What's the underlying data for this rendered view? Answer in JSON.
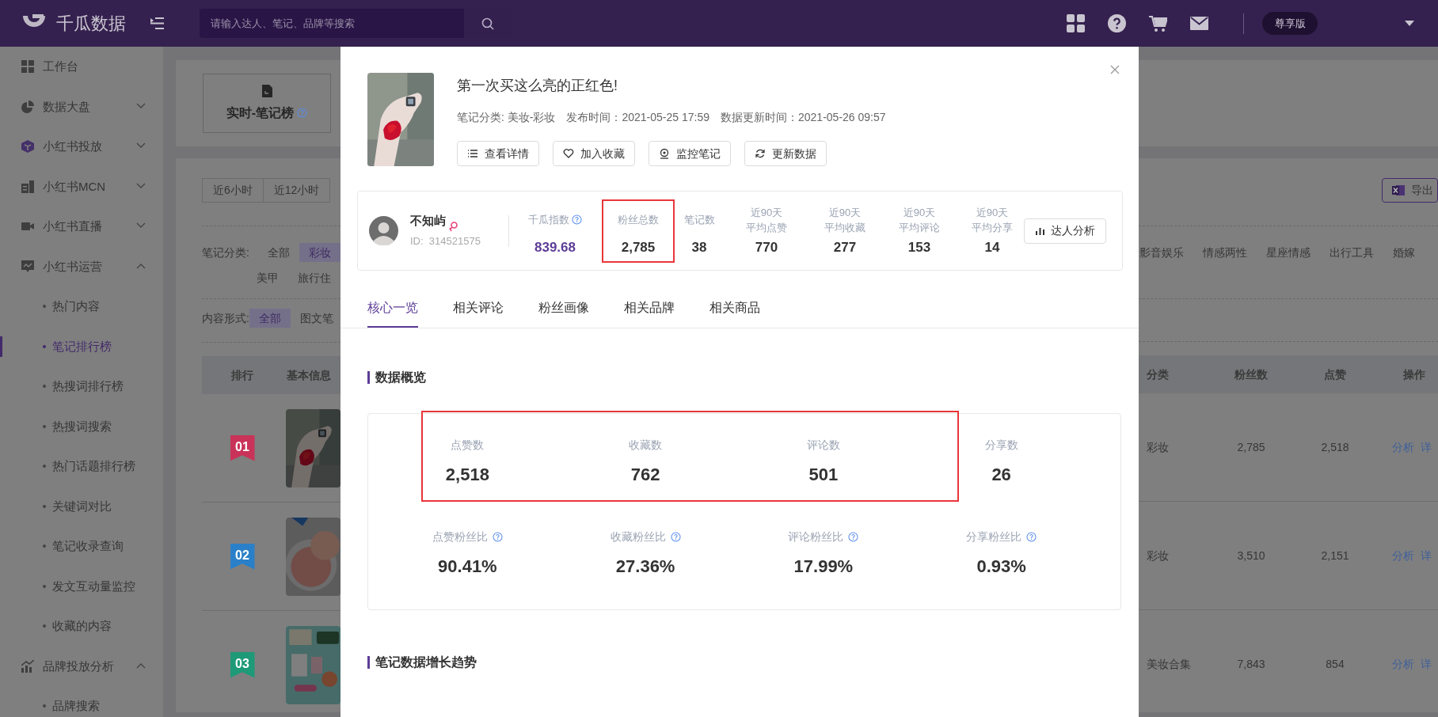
{
  "top_bar": {
    "brand": "千瓜数据",
    "search": {
      "placeholder": "请输入达人、笔记、品牌等搜索"
    },
    "plan_badge": "尊享版"
  },
  "sidebar": {
    "items": [
      {
        "label": "工作台",
        "selected": false
      },
      {
        "label": "数据大盘",
        "expanded": false,
        "selected": false
      },
      {
        "label": "小红书投放",
        "expanded": false,
        "selected": false
      },
      {
        "label": "小红书MCN",
        "expanded": false,
        "selected": false
      },
      {
        "label": "小红书直播",
        "expanded": false,
        "selected": false
      },
      {
        "label": "小红书运营",
        "expanded": true,
        "selected": false,
        "children": [
          {
            "label": "热门内容",
            "selected": false
          },
          {
            "label": "笔记排行榜",
            "selected": true
          },
          {
            "label": "热搜词排行榜",
            "selected": false
          },
          {
            "label": "热搜词搜索",
            "selected": false
          },
          {
            "label": "热门话题排行榜",
            "selected": false
          },
          {
            "label": "关键词对比",
            "selected": false
          },
          {
            "label": "笔记收录查询",
            "selected": false
          },
          {
            "label": "发文互动量监控",
            "selected": false
          },
          {
            "label": "收藏的内容",
            "selected": false
          }
        ]
      },
      {
        "label": "品牌投放分析",
        "expanded": true,
        "selected": false,
        "children": [
          {
            "label": "品牌搜索",
            "selected": false
          }
        ]
      }
    ]
  },
  "ranking_tab": {
    "label": "实时-笔记榜"
  },
  "time_filters": [
    {
      "label": "近6小时",
      "selected": false
    },
    {
      "label": "近12小时",
      "selected": false
    }
  ],
  "export_button": "导出",
  "note_category": {
    "label": "笔记分类:",
    "rows": [
      {
        "left": [
          {
            "label": "全部",
            "selected": false
          },
          {
            "label": "彩妆",
            "selected": true
          }
        ],
        "right": [
          {
            "label": "影音娱乐",
            "selected": false
          },
          {
            "label": "情感两性",
            "selected": false
          },
          {
            "label": "星座情感",
            "selected": false
          },
          {
            "label": "出行工具",
            "selected": false
          },
          {
            "label": "婚嫁",
            "selected": false
          }
        ]
      },
      {
        "left": [
          {
            "label": "美甲",
            "selected": false
          },
          {
            "label": "旅行住",
            "selected": false
          }
        ],
        "right": []
      }
    ]
  },
  "content_format": {
    "label": "内容形式:",
    "options": [
      {
        "label": "全部",
        "selected": true
      },
      {
        "label": "图文笔",
        "selected": false
      }
    ]
  },
  "table": {
    "columns": [
      "排行",
      "基本信息",
      "分类",
      "粉丝数",
      "点赞",
      "操作"
    ],
    "rows": [
      {
        "rank": "01",
        "color": "#c93359",
        "category": "彩妆",
        "fans": "2,785",
        "likes": "2,518",
        "actions": [
          "分析",
          "详"
        ]
      },
      {
        "rank": "02",
        "color": "#2a80c8",
        "category": "彩妆",
        "fans": "3,510",
        "likes": "2,151",
        "actions": [
          "分析",
          "详"
        ]
      },
      {
        "rank": "03",
        "color": "#1e9a78",
        "category": "美妆合集",
        "fans": "7,843",
        "likes": "854",
        "actions": [
          "分析",
          "详"
        ]
      }
    ]
  },
  "modal": {
    "title": "第一次买这么亮的正红色!",
    "meta": [
      "笔记分类: 美妆-彩妆",
      "发布时间：2021-05-25 17:59",
      "数据更新时间：2021-05-26 09:57"
    ],
    "actions": [
      "查看详情",
      "加入收藏",
      "监控笔记",
      "更新数据"
    ],
    "author": {
      "name": "不知屿",
      "id": "ID:  314521575"
    },
    "author_stats": [
      {
        "label_lines": [
          "千瓜指数"
        ],
        "value": "839.68",
        "kind": "index",
        "help": true,
        "highlighted": false
      },
      {
        "label_lines": [
          "粉丝总数"
        ],
        "value": "2,785",
        "kind": "plain",
        "help": false,
        "highlighted": true
      },
      {
        "label_lines": [
          "笔记数"
        ],
        "value": "38",
        "kind": "plain",
        "help": false,
        "highlighted": false
      },
      {
        "label_lines": [
          "近90天",
          "平均点赞"
        ],
        "value": "770",
        "kind": "plain",
        "help": false,
        "highlighted": false
      },
      {
        "label_lines": [
          "近90天",
          "平均收藏"
        ],
        "value": "277",
        "kind": "plain",
        "help": false,
        "highlighted": false
      },
      {
        "label_lines": [
          "近90天",
          "平均评论"
        ],
        "value": "153",
        "kind": "plain",
        "help": false,
        "highlighted": false
      },
      {
        "label_lines": [
          "近90天",
          "平均分享"
        ],
        "value": "14",
        "kind": "plain",
        "help": false,
        "highlighted": false
      }
    ],
    "author_button": "达人分析",
    "tabs": [
      {
        "label": "核心一览",
        "selected": true
      },
      {
        "label": "相关评论",
        "selected": false
      },
      {
        "label": "粉丝画像",
        "selected": false
      },
      {
        "label": "相关品牌",
        "selected": false
      },
      {
        "label": "相关商品",
        "selected": false
      }
    ],
    "overview": {
      "title": "数据概览",
      "metrics": [
        {
          "label": "点赞数",
          "value": "2,518",
          "highlighted": true
        },
        {
          "label": "收藏数",
          "value": "762",
          "highlighted": true
        },
        {
          "label": "评论数",
          "value": "501",
          "highlighted": true
        },
        {
          "label": "分享数",
          "value": "26",
          "highlighted": false
        }
      ],
      "ratios": [
        {
          "label": "点赞粉丝比",
          "value": "90.41%"
        },
        {
          "label": "收藏粉丝比",
          "value": "27.36%"
        },
        {
          "label": "评论粉丝比",
          "value": "17.99%"
        },
        {
          "label": "分享粉丝比",
          "value": "0.93%"
        }
      ]
    },
    "trend": {
      "title": "笔记数据增长趋势"
    }
  }
}
